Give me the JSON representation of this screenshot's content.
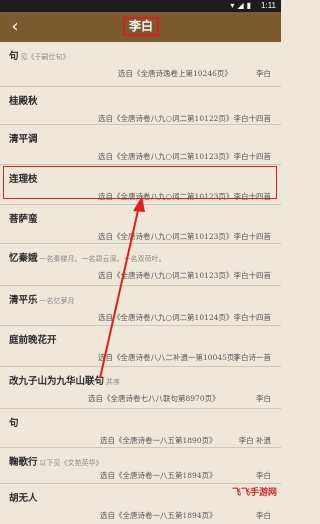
{
  "status": {
    "time": "1:11"
  },
  "header": {
    "title": "李白",
    "back_icon": "back-chevron-icon"
  },
  "entries": [
    {
      "title": "句",
      "note": "见《于嗣仕句》",
      "source": "选自《全唐诗逸卷上第10246页》",
      "author": "李白"
    },
    {
      "title": "桂殿秋",
      "note": "",
      "source": "选自《全唐诗卷八九○词二第10122页》",
      "author": "李白十四首"
    },
    {
      "title": "清平调",
      "note": "",
      "source": "选自《全唐诗卷八九○词二第10123页》",
      "author": "李白十四首"
    },
    {
      "title": "连理枝",
      "note": "",
      "source": "选自《全唐诗卷八九○词二第10123页》",
      "author": "李白十四首"
    },
    {
      "title": "菩萨蛮",
      "note": "",
      "source": "选自《全唐诗卷八九○词二第10123页》",
      "author": "李白十四首"
    },
    {
      "title": "忆秦娥",
      "note": "一名秦楼月。一名碧云深。一名双荷叶。",
      "source": "选自《全唐诗卷八九○词二第10123页》",
      "author": "李白十四首"
    },
    {
      "title": "清平乐",
      "note": "一名忆萝月",
      "source": "选自《全唐诗卷八九○词二第10124页》",
      "author": "李白十四首"
    },
    {
      "title": "庭前晚花开",
      "note": "",
      "source": "选自《全唐诗卷八八二补遗一第10045页》",
      "author": "李白诗一首"
    },
    {
      "title": "改九子山为九华山联句",
      "note": "并序",
      "source": "选自《全唐诗卷七八八联句第8970页》",
      "author": "李白"
    },
    {
      "title": "句",
      "note": "",
      "source": "选自《全唐诗卷一八五第1890页》",
      "author": "李白 补遗"
    },
    {
      "title": "鞠歌行",
      "note": "以下见《文苑英华》",
      "source": "选自《全唐诗卷一八五第1894页》",
      "author": "李白"
    },
    {
      "title": "胡无人",
      "note": "",
      "source": "选自《全唐诗卷一八五第1894页》",
      "author": "李白"
    }
  ],
  "watermark": "飞飞手游网"
}
